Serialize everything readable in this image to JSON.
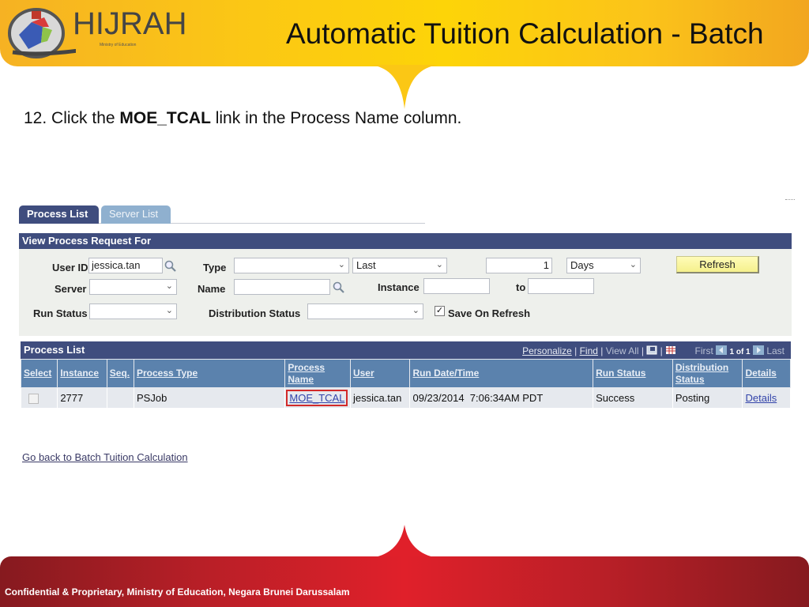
{
  "header": {
    "logo_text": "HIJRAH",
    "logo_tagline": "Ministry of Education",
    "title": "Automatic Tuition Calculation - Batch",
    "brand_color": "#fbc715"
  },
  "instruction": {
    "prefix": "12. Click the ",
    "emphasis": "MOE_TCAL",
    "suffix": " link in the Process Name column."
  },
  "tabs": [
    {
      "label": "Process List",
      "active": true
    },
    {
      "label": "Server List",
      "active": false
    }
  ],
  "view_process_request": {
    "heading": "View Process Request For",
    "user_id_label": "User ID",
    "user_id_value": "jessica.tan",
    "type_label": "Type",
    "type_value": "",
    "last_value": "Last",
    "count_value": "1",
    "unit_value": "Days",
    "refresh_label": "Refresh",
    "server_label": "Server",
    "server_value": "",
    "name_label": "Name",
    "name_value": "",
    "instance_label": "Instance",
    "instance_from": "",
    "to_label": "to",
    "instance_to": "",
    "run_status_label": "Run Status",
    "run_status_value": "",
    "distribution_status_label": "Distribution Status",
    "distribution_status_value": "",
    "save_on_refresh_label": "Save On Refresh",
    "save_on_refresh_checked": true
  },
  "process_list": {
    "heading": "Process List",
    "nav": {
      "personalize": "Personalize",
      "find": "Find",
      "view_all": "View All",
      "first": "First",
      "page": "1 of 1",
      "last": "Last"
    },
    "columns": [
      "Select",
      "Instance",
      "Seq.",
      "Process Type",
      "Process Name",
      "User",
      "Run Date/Time",
      "Run Status",
      "Distribution Status",
      "Details"
    ],
    "rows": [
      {
        "select": false,
        "instance": "2777",
        "seq": "",
        "process_type": "PSJob",
        "process_name": "MOE_TCAL",
        "user": "jessica.tan",
        "run_datetime": "09/23/2014  7:06:34AM PDT",
        "run_status": "Success",
        "distribution_status": "Posting",
        "details": "Details"
      }
    ]
  },
  "back_link": "Go back to Batch Tuition Calculation",
  "footer": {
    "text": "Confidential & Proprietary, Ministry of Education, Negara Brunei Darussalam",
    "color": "#e0202a"
  }
}
